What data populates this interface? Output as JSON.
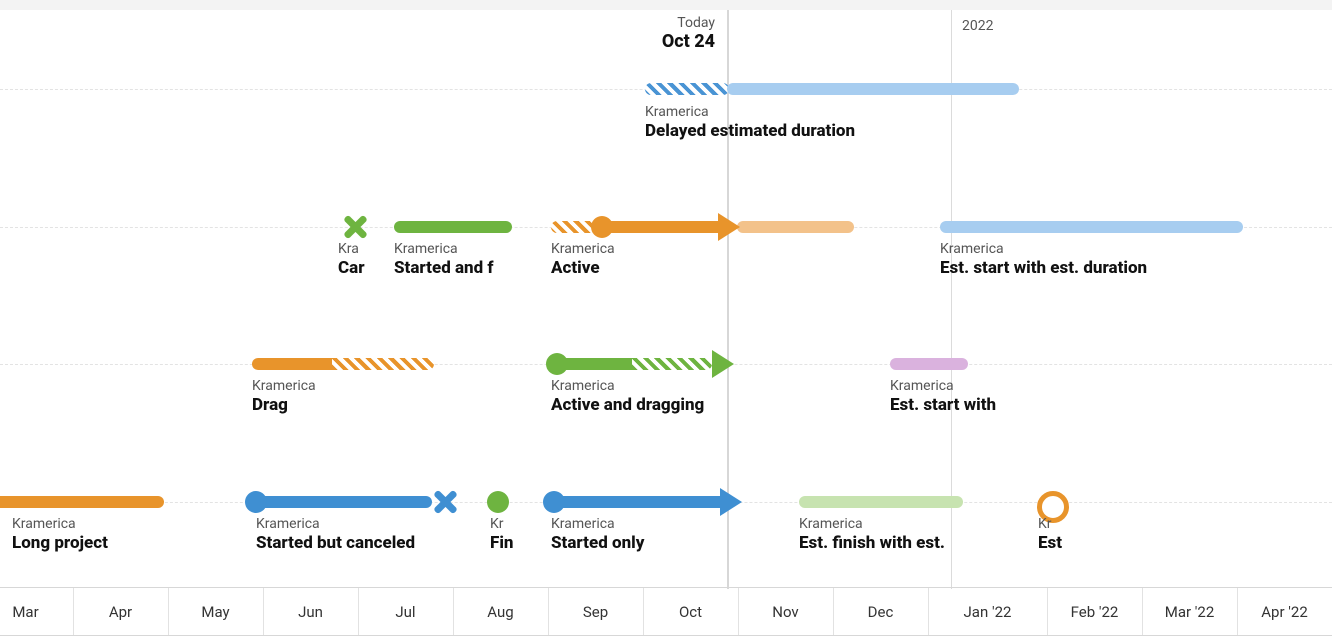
{
  "today": {
    "label": "Today",
    "date": "Oct 24"
  },
  "year_marker": "2022",
  "months": [
    "Mar",
    "Apr",
    "May",
    "Jun",
    "Jul",
    "Aug",
    "Sep",
    "Oct",
    "Nov",
    "Dec",
    "Jan '22",
    "Feb '22",
    "Mar '22",
    "Apr '22"
  ],
  "items": {
    "delayed": {
      "org": "Kramerica",
      "title": "Delayed estimated duration"
    },
    "canceled_g": {
      "org": "Kra",
      "title": "Car"
    },
    "started_finished": {
      "org": "Kramerica",
      "title": "Started and f"
    },
    "active": {
      "org": "Kramerica",
      "title": "Active"
    },
    "est_start_dur": {
      "org": "Kramerica",
      "title": "Est. start with est. duration"
    },
    "drag": {
      "org": "Kramerica",
      "title": "Drag"
    },
    "active_drag": {
      "org": "Kramerica",
      "title": "Active and dragging"
    },
    "est_start": {
      "org": "Kramerica",
      "title": "Est. start with"
    },
    "long": {
      "org": "Kramerica",
      "title": "Long project"
    },
    "started_canceled": {
      "org": "Kramerica",
      "title": "Started but canceled"
    },
    "fin_dot": {
      "org": "Kr",
      "title": "Fin"
    },
    "started_only": {
      "org": "Kramerica",
      "title": "Started only"
    },
    "est_finish": {
      "org": "Kramerica",
      "title": "Est. finish with est."
    },
    "est_ring": {
      "org": "Kr",
      "title": "Est"
    }
  },
  "chart_data": {
    "type": "gantt",
    "x_axis": {
      "start": "2021-02-15",
      "end": "2022-04-15",
      "today": "2021-10-24",
      "year_boundaries": [
        "2022-01-01"
      ],
      "tick_labels": [
        "Mar",
        "Apr",
        "May",
        "Jun",
        "Jul",
        "Aug",
        "Sep",
        "Oct",
        "Nov",
        "Dec",
        "Jan '22",
        "Feb '22",
        "Mar '22",
        "Apr '22"
      ]
    },
    "lanes": [
      {
        "y_index": 0,
        "items": [
          {
            "id": "delayed",
            "org": "Kramerica",
            "title": "Delayed estimated duration",
            "segments": [
              {
                "kind": "hatched",
                "color": "blue",
                "start": "2021-10-01",
                "end": "2021-10-24"
              },
              {
                "kind": "solid",
                "color": "skyblue",
                "start": "2021-10-24",
                "end": "2022-01-18"
              }
            ],
            "markers": []
          }
        ]
      },
      {
        "y_index": 1,
        "items": [
          {
            "id": "canceled_g",
            "org": "Kramerica",
            "title": "Canceled (green X)",
            "segments": [],
            "markers": [
              {
                "kind": "x",
                "color": "green",
                "at": "2021-06-10"
              }
            ]
          },
          {
            "id": "started_finished",
            "org": "Kramerica",
            "title": "Started and finished",
            "segments": [
              {
                "kind": "solid",
                "color": "green",
                "start": "2021-06-25",
                "end": "2021-08-04"
              }
            ],
            "markers": []
          },
          {
            "id": "active",
            "org": "Kramerica",
            "title": "Active",
            "segments": [
              {
                "kind": "hatched",
                "color": "orange",
                "start": "2021-08-20",
                "end": "2021-09-04"
              },
              {
                "kind": "solid",
                "color": "orange",
                "start": "2021-09-04",
                "end": "2021-10-24"
              },
              {
                "kind": "solid",
                "color": "orange-lt",
                "start": "2021-10-24",
                "end": "2021-12-01"
              }
            ],
            "markers": [
              {
                "kind": "dot",
                "color": "orange",
                "at": "2021-09-04"
              },
              {
                "kind": "arrow",
                "color": "orange",
                "at": "2021-10-24"
              }
            ]
          },
          {
            "id": "est_start_dur",
            "org": "Kramerica",
            "title": "Est. start with est. duration",
            "segments": [
              {
                "kind": "solid",
                "color": "skyblue",
                "start": "2022-01-05",
                "end": "2022-04-01"
              }
            ],
            "markers": []
          }
        ]
      },
      {
        "y_index": 2,
        "items": [
          {
            "id": "drag",
            "org": "Kramerica",
            "title": "Drag",
            "segments": [
              {
                "kind": "solid",
                "color": "orange",
                "start": "2021-05-05",
                "end": "2021-06-07"
              },
              {
                "kind": "hatched",
                "color": "orange",
                "start": "2021-06-07",
                "end": "2021-07-16"
              }
            ],
            "markers": []
          },
          {
            "id": "active_drag",
            "org": "Kramerica",
            "title": "Active and dragging",
            "segments": [
              {
                "kind": "solid",
                "color": "green",
                "start": "2021-08-24",
                "end": "2021-09-20"
              },
              {
                "kind": "hatched",
                "color": "green",
                "start": "2021-09-20",
                "end": "2021-10-20"
              }
            ],
            "markers": [
              {
                "kind": "dot",
                "color": "green",
                "at": "2021-08-24"
              },
              {
                "kind": "arrow",
                "color": "green",
                "at": "2021-10-24"
              }
            ]
          },
          {
            "id": "est_start",
            "org": "Kramerica",
            "title": "Est. start with",
            "segments": [
              {
                "kind": "solid",
                "color": "lilac",
                "start": "2021-12-10",
                "end": "2022-01-02"
              }
            ],
            "markers": []
          }
        ]
      },
      {
        "y_index": 3,
        "items": [
          {
            "id": "long",
            "org": "Kramerica",
            "title": "Long project",
            "segments": [
              {
                "kind": "solid",
                "color": "orange",
                "start": "2021-02-15",
                "end": "2021-04-16"
              }
            ],
            "markers": []
          },
          {
            "id": "started_canceled",
            "org": "Kramerica",
            "title": "Started but canceled",
            "segments": [
              {
                "kind": "solid",
                "color": "blue",
                "start": "2021-05-04",
                "end": "2021-07-14"
              }
            ],
            "markers": [
              {
                "kind": "dot",
                "color": "blue",
                "at": "2021-05-04"
              },
              {
                "kind": "x",
                "color": "blue",
                "at": "2021-07-14"
              }
            ]
          },
          {
            "id": "fin_dot",
            "org": "Kramerica",
            "title": "Finished",
            "segments": [],
            "markers": [
              {
                "kind": "dot",
                "color": "green",
                "at": "2021-08-01"
              }
            ]
          },
          {
            "id": "started_only",
            "org": "Kramerica",
            "title": "Started only",
            "segments": [
              {
                "kind": "solid",
                "color": "blue",
                "start": "2021-08-22",
                "end": "2021-10-24"
              }
            ],
            "markers": [
              {
                "kind": "dot",
                "color": "blue",
                "at": "2021-08-22"
              },
              {
                "kind": "arrow",
                "color": "blue",
                "at": "2021-10-24"
              }
            ]
          },
          {
            "id": "est_finish",
            "org": "Kramerica",
            "title": "Est. finish with est.",
            "segments": [
              {
                "kind": "solid",
                "color": "green-lt",
                "start": "2021-11-12",
                "end": "2022-01-02"
              }
            ],
            "markers": []
          },
          {
            "id": "est_ring",
            "org": "Kramerica",
            "title": "Est.",
            "segments": [],
            "markers": [
              {
                "kind": "ring",
                "color": "orange",
                "at": "2022-01-25"
              }
            ]
          }
        ]
      }
    ]
  }
}
